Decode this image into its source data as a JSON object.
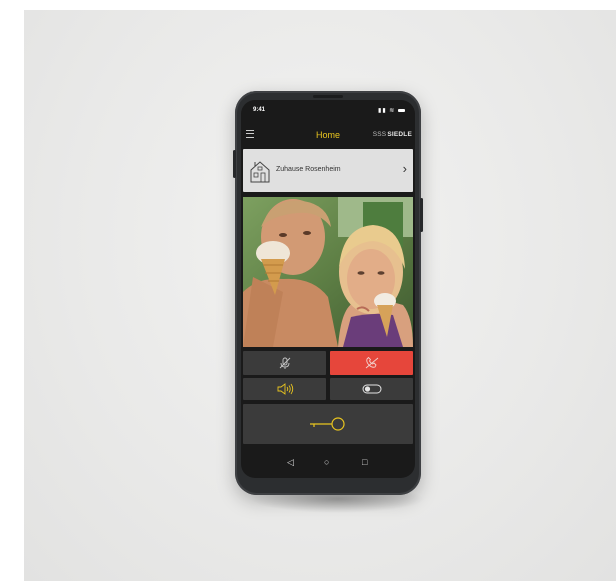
{
  "status_bar": {
    "time": "9:41"
  },
  "header": {
    "title": "Home",
    "brand": "SIEDLE",
    "brand_mark": "SSS"
  },
  "location": {
    "name": "Zuhause Rosenheim"
  },
  "icons": {
    "menu": "hamburger-icon",
    "house": "house-icon",
    "chevron": "chevron-right-icon",
    "mute": "microphone-muted-icon",
    "hangup": "phone-hangup-icon",
    "speaker": "speaker-icon",
    "toggle": "toggle-switch-icon",
    "door": "door-key-icon"
  },
  "colors": {
    "accent": "#e9c51f",
    "hangup": "#e6463b",
    "button_bg": "#3b3b3b",
    "location_bg": "#e0e0e0",
    "screen_bg": "#1a1a1a"
  },
  "nav": {
    "back": "◁",
    "home": "○",
    "recents": "□"
  }
}
